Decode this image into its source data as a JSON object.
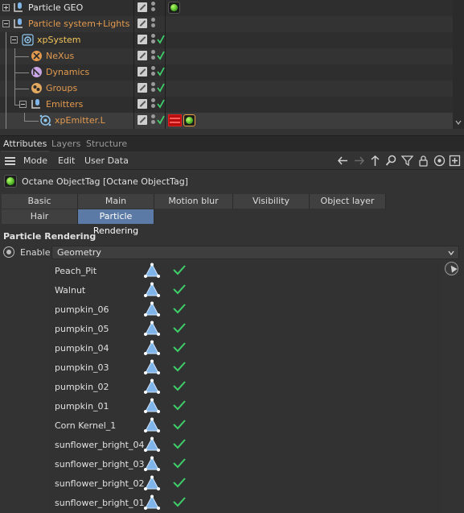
{
  "object_manager": {
    "rows": [
      {
        "name": "Particle GEO",
        "color": "white"
      },
      {
        "name": "Particle system+Lights",
        "color": "orange"
      },
      {
        "name": "xpSystem",
        "color": "yellow"
      },
      {
        "name": "NeXus",
        "color": "orange"
      },
      {
        "name": "Dynamics",
        "color": "orange"
      },
      {
        "name": "Groups",
        "color": "orange"
      },
      {
        "name": "Emitters",
        "color": "orange"
      },
      {
        "name": "xpEmitter.L",
        "color": "orange"
      }
    ]
  },
  "manager_tabs": [
    "Attributes",
    "Layers",
    "Structure"
  ],
  "menu": {
    "mode": "Mode",
    "edit": "Edit",
    "user_data": "User Data"
  },
  "object_title": "Octane ObjectTag [Octane ObjectTag]",
  "attr_tabs": {
    "row1": [
      "Basic",
      "Main",
      "Motion blur",
      "Visibility",
      "Object layer"
    ],
    "row2": [
      "Hair",
      "Particle Rendering"
    ],
    "active": "Particle Rendering"
  },
  "section": {
    "title": "Particle Rendering",
    "enable_label": "Enable",
    "mode_value": "Geometry"
  },
  "geometry_list": [
    "Peach_Pit",
    "Walnut",
    "pumpkin_06",
    "pumpkin_05",
    "pumpkin_04",
    "pumpkin_03",
    "pumpkin_02",
    "pumpkin_01",
    "Corn Kernel_1",
    "sunflower_bright_04",
    "sunflower_bright_03",
    "sunflower_bright_02",
    "sunflower_bright_01"
  ],
  "colors": {
    "accent": "#5b7aa5",
    "check": "#3fcf6a",
    "orange_label": "#e39a4e",
    "yellow_label": "#f2c55a"
  }
}
